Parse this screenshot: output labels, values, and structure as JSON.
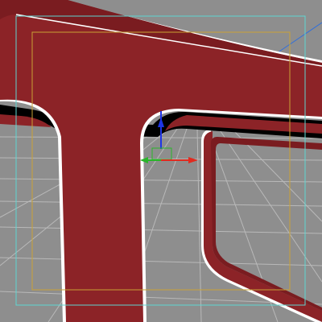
{
  "viewport": {
    "background_color": "#8e8e8e",
    "grid_line_color": "#b9b9b9",
    "model_color": "#8c2327",
    "model_shadow_color": "#7a1c20",
    "model_outline_color": "#ffffff",
    "safe_frame_outer_color": "#5fd6d2",
    "safe_frame_inner_color": "#c9a235",
    "light_line_color": "#2f6fdc"
  },
  "gizmo": {
    "type": "move",
    "icon": "move-transform-gizmo-icon",
    "x_axis_color": "#e12a1f",
    "y_axis_color": "#2ab52a",
    "z_axis_color": "#1f35e6",
    "plane_handle_colors": [
      "#e12a1f",
      "#2ab52a"
    ]
  }
}
